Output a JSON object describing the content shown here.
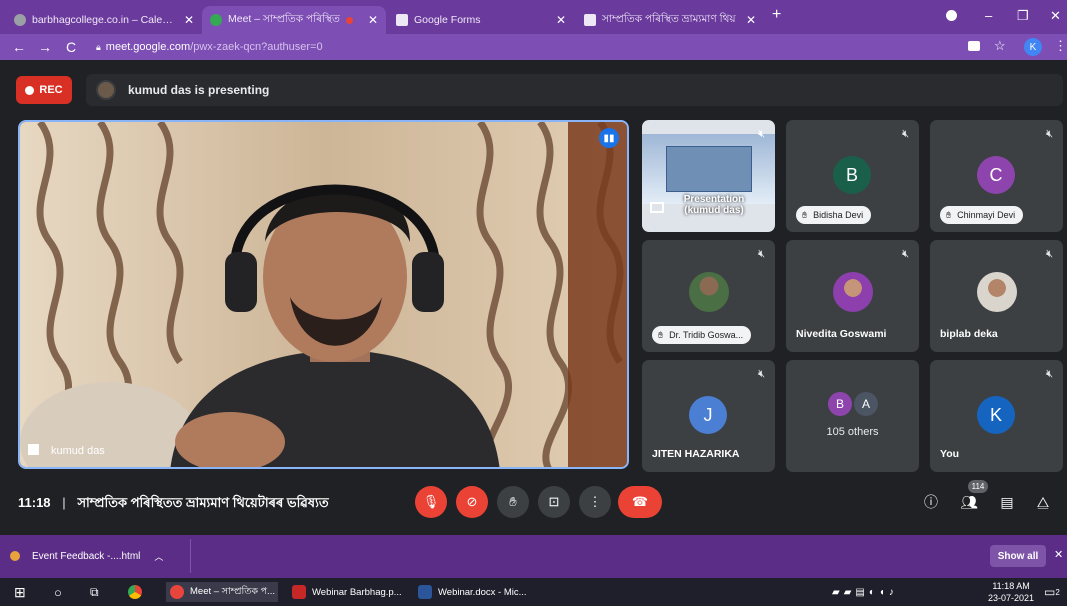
{
  "browser": {
    "tabs": [
      {
        "title": "barbhagcollege.co.in – Calendar",
        "active": false
      },
      {
        "title": "Meet – সাম্প্ৰতিক পৰিস্থিত",
        "active": true
      },
      {
        "title": "Google Forms",
        "active": false
      },
      {
        "title": "সাম্প্ৰতিক পৰিস্থিত ভ্ৰাম্যমাণ থিয়",
        "active": false
      }
    ],
    "new_tab": "+",
    "url_host": "meet.google.com",
    "url_path": "/pwx-zaek-qcn?authuser=0",
    "profile_initial": "K"
  },
  "meet": {
    "rec_label": "REC",
    "presenting_text": "kumud das is presenting",
    "main_speaker": "kumud das",
    "tiles": [
      {
        "kind": "presentation",
        "label": "Presentation\n(kumud das)"
      },
      {
        "kind": "avatar",
        "initial": "B",
        "name": "Bidisha Devi",
        "color": "#1a5f4a",
        "pill": true
      },
      {
        "kind": "avatar",
        "initial": "C",
        "name": "Chinmayi Devi",
        "color": "#8e44ad",
        "pill": true
      },
      {
        "kind": "photo",
        "name": "Dr. Tridib Goswa...",
        "pill": true
      },
      {
        "kind": "photo",
        "name": "Nivedita Goswami",
        "pill": false
      },
      {
        "kind": "photo",
        "name": "biplab deka",
        "pill": false
      },
      {
        "kind": "avatar",
        "initial": "J",
        "name": "JITEN HAZARIKA",
        "color": "#4a7fd4",
        "pill": false
      },
      {
        "kind": "others",
        "initials": [
          "B",
          "A"
        ],
        "name": "105 others"
      },
      {
        "kind": "avatar",
        "initial": "K",
        "name": "You",
        "color": "#1565c0",
        "pill": false
      }
    ],
    "time": "11:18",
    "meeting_title": "সাম্প্ৰতিক পৰিস্থিতত ভ্ৰাম্যমাণ থিয়েটাৰৰ ভৱিষ্যত",
    "participant_count": "114",
    "colors": {
      "accent": "#8ab4f8",
      "danger": "#ea4335",
      "tile": "#3c4043",
      "chrome": "#6a3a9c"
    }
  },
  "downloads": {
    "item": "Event Feedback -....html",
    "show_all": "Show all"
  },
  "taskbar": {
    "apps": [
      {
        "label": "Meet – সাম্প্ৰতিক প...",
        "color": "#e8453c"
      },
      {
        "label": "Webinar Barbhag.p...",
        "color": "#c62828"
      },
      {
        "label": "Webinar.docx - Mic...",
        "color": "#2b579a"
      }
    ],
    "time": "11:18 AM",
    "date": "23-07-2021",
    "notification_count": "2"
  }
}
